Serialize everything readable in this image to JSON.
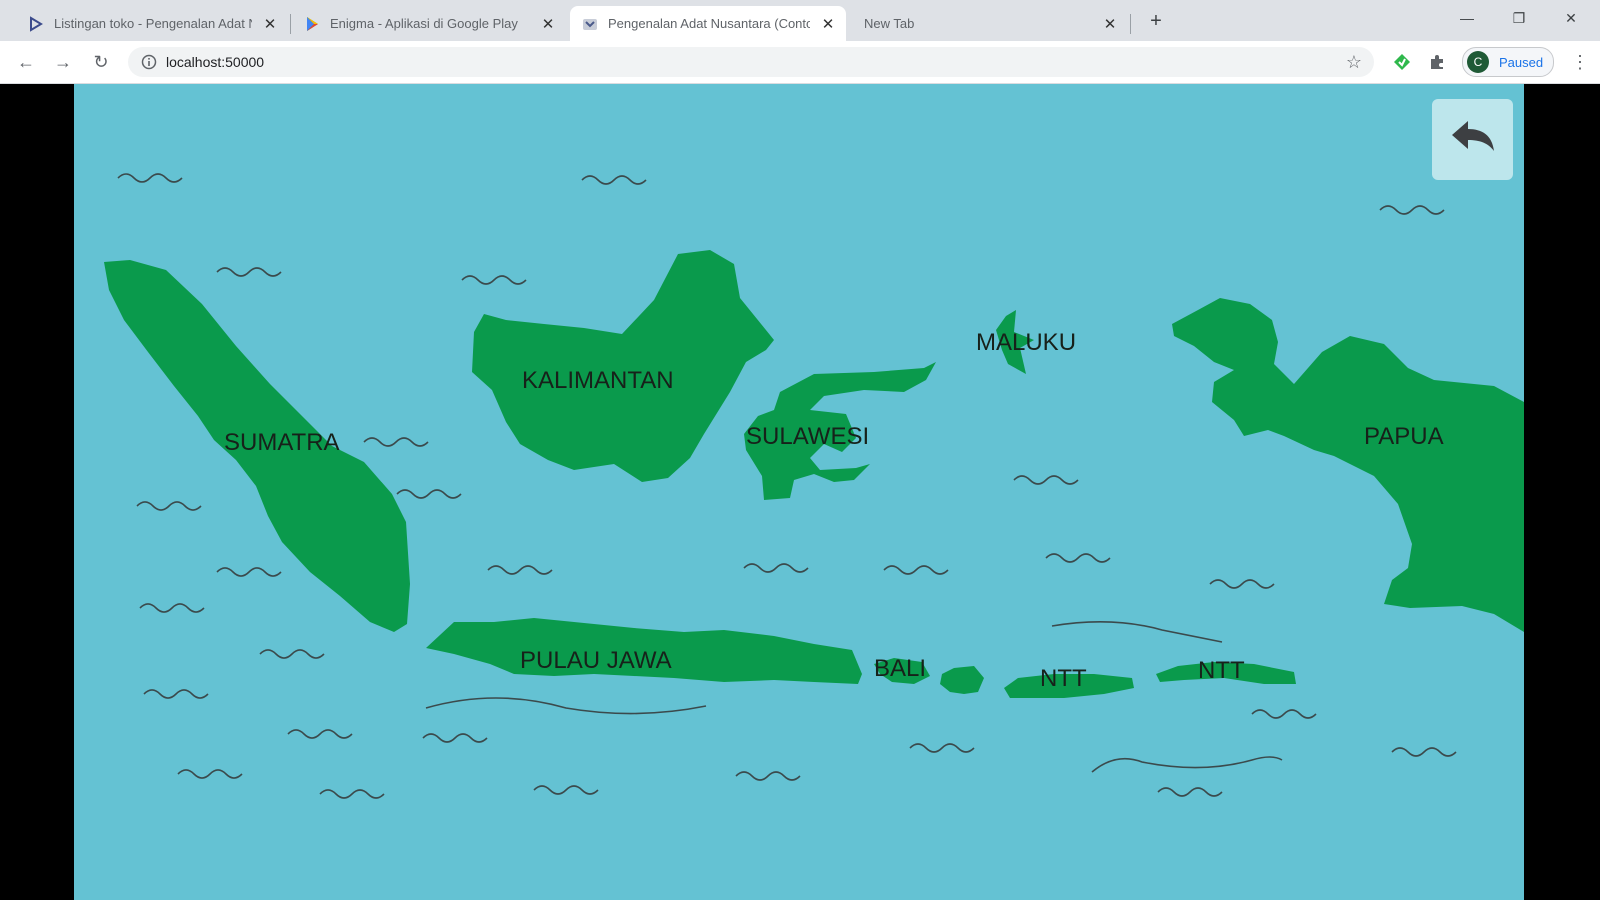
{
  "browser": {
    "tabs": [
      {
        "title": "Listingan toko - Pengenalan Adat Nusantara",
        "icon": "play-console-icon",
        "active": false
      },
      {
        "title": "Enigma - Aplikasi di Google Play",
        "icon": "google-play-icon",
        "active": false
      },
      {
        "title": "Pengenalan Adat Nusantara (Contoh)",
        "icon": "app-favicon-icon",
        "active": true
      },
      {
        "title": "New Tab",
        "icon": "",
        "active": false
      }
    ],
    "url": "localhost:50000",
    "profile_initial": "C",
    "profile_status": "Paused"
  },
  "game": {
    "colors": {
      "sea": "#64c2d3",
      "land": "#0a9a4c",
      "wave": "#3b4a4c",
      "back_button": "#bde6ec"
    },
    "back_button_icon": "back-arrow-icon",
    "regions": [
      {
        "id": "sumatra",
        "label": "SUMATRA"
      },
      {
        "id": "kalimantan",
        "label": "KALIMANTAN"
      },
      {
        "id": "sulawesi",
        "label": "SULAWESI"
      },
      {
        "id": "maluku",
        "label": "MALUKU"
      },
      {
        "id": "papua",
        "label": "PAPUA"
      },
      {
        "id": "jawa",
        "label": "PULAU JAWA"
      },
      {
        "id": "bali",
        "label": "BALI"
      },
      {
        "id": "ntb",
        "label": "NTT"
      },
      {
        "id": "ntt",
        "label": "NTT"
      }
    ]
  }
}
